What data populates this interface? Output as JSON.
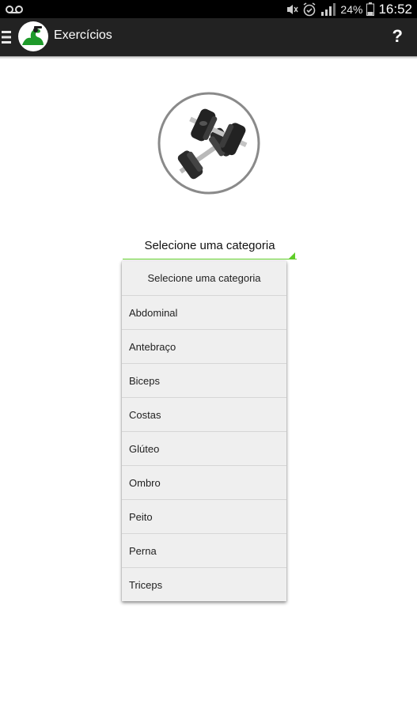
{
  "status_bar": {
    "battery": "24%",
    "time": "16:52",
    "icons": [
      "voicemail-icon",
      "mute-icon",
      "alarm-icon",
      "signal-icon",
      "battery-icon"
    ]
  },
  "action_bar": {
    "title": "Exercícios",
    "help_label": "?"
  },
  "spinner": {
    "selected": "Selecione uma categoria",
    "accent_color": "#5fcd28"
  },
  "dropdown": {
    "options": [
      "Selecione uma categoria",
      "Abdominal",
      "Antebraço",
      "Biceps",
      "Costas",
      "Glúteo",
      "Ombro",
      "Peito",
      "Perna",
      "Triceps"
    ]
  },
  "colors": {
    "action_bar": "#222222",
    "status_bar": "#000000",
    "accent": "#5fcd28",
    "dropdown_bg": "#efefef"
  }
}
